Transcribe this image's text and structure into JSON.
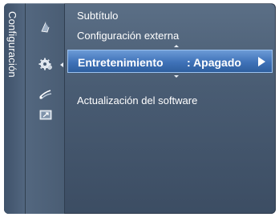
{
  "sidebar": {
    "title": "Configuración",
    "icons": [
      "picture-icon",
      "settings-gear-icon",
      "network-icon",
      "input-source-icon"
    ],
    "selected_index": 1
  },
  "menu": {
    "items": [
      {
        "label": "Subtítulo"
      },
      {
        "label": "Configuración externa"
      },
      {
        "label": "Entretenimiento",
        "value": ": Apagado",
        "selected": true
      },
      {
        "label": "Actualización del software"
      }
    ]
  },
  "colors": {
    "panel": "#495c73",
    "highlight": "#3f72b8",
    "text": "#ffffff"
  }
}
